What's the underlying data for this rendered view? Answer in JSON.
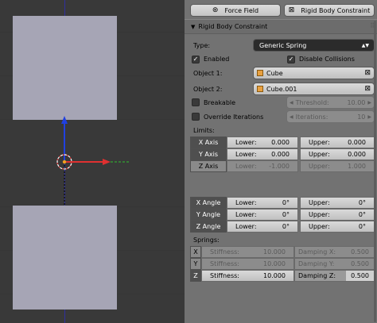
{
  "panel": {
    "buttons": {
      "force_field": "Force Field",
      "rigid_body_constraint": "Rigid Body Constraint"
    },
    "header_title": "Rigid Body Constraint",
    "type_label": "Type:",
    "type_value": "Generic Spring",
    "enabled_label": "Enabled",
    "disable_collisions_label": "Disable Collisions",
    "object1_label": "Object 1:",
    "object1_value": "Cube",
    "object2_label": "Object 2:",
    "object2_value": "Cube.001",
    "breakable_label": "Breakable",
    "threshold": "Threshold:",
    "threshold_value": "10.00",
    "override_label": "Override Iterations",
    "iterations": "Iterations:",
    "iterations_value": "10",
    "limits_label": "Limits:",
    "limits": [
      {
        "axis": "X Axis",
        "lower_label": "Lower:",
        "lower": "0.000",
        "upper_label": "Upper:",
        "upper": "0.000",
        "enabled": true
      },
      {
        "axis": "Y Axis",
        "lower_label": "Lower:",
        "lower": "0.000",
        "upper_label": "Upper:",
        "upper": "0.000",
        "enabled": true
      },
      {
        "axis": "Z Axis",
        "lower_label": "Lower:",
        "lower": "-1.000",
        "upper_label": "Upper:",
        "upper": "1.000",
        "enabled": false
      },
      {
        "axis": "X Angle",
        "lower_label": "Lower:",
        "lower": "0°",
        "upper_label": "Upper:",
        "upper": "0°",
        "enabled": true
      },
      {
        "axis": "Y Angle",
        "lower_label": "Lower:",
        "lower": "0°",
        "upper_label": "Upper:",
        "upper": "0°",
        "enabled": true
      },
      {
        "axis": "Z Angle",
        "lower_label": "Lower:",
        "lower": "0°",
        "upper_label": "Upper:",
        "upper": "0°",
        "enabled": true
      }
    ],
    "springs_label": "Springs:",
    "springs": [
      {
        "axis": "X",
        "stiffness_label": "Stiffness:",
        "stiffness": "10.000",
        "damping_label": "Damping X:",
        "damping": "0.500",
        "enabled": false
      },
      {
        "axis": "Y",
        "stiffness_label": "Stiffness:",
        "stiffness": "10.000",
        "damping_label": "Damping Y:",
        "damping": "0.500",
        "enabled": false
      },
      {
        "axis": "Z",
        "stiffness_label": "Stiffness:",
        "stiffness": "10.000",
        "damping_label": "Damping Z:",
        "damping": "0.500",
        "enabled": true
      }
    ]
  },
  "colors": {
    "viewport_bg": "#393939",
    "cube": "#a6a5b5",
    "panel_bg": "#727272",
    "axis_x": "#e03030",
    "axis_y": "#30c030",
    "axis_z": "#2040e0",
    "selected_dark": "#2b2b2b"
  }
}
